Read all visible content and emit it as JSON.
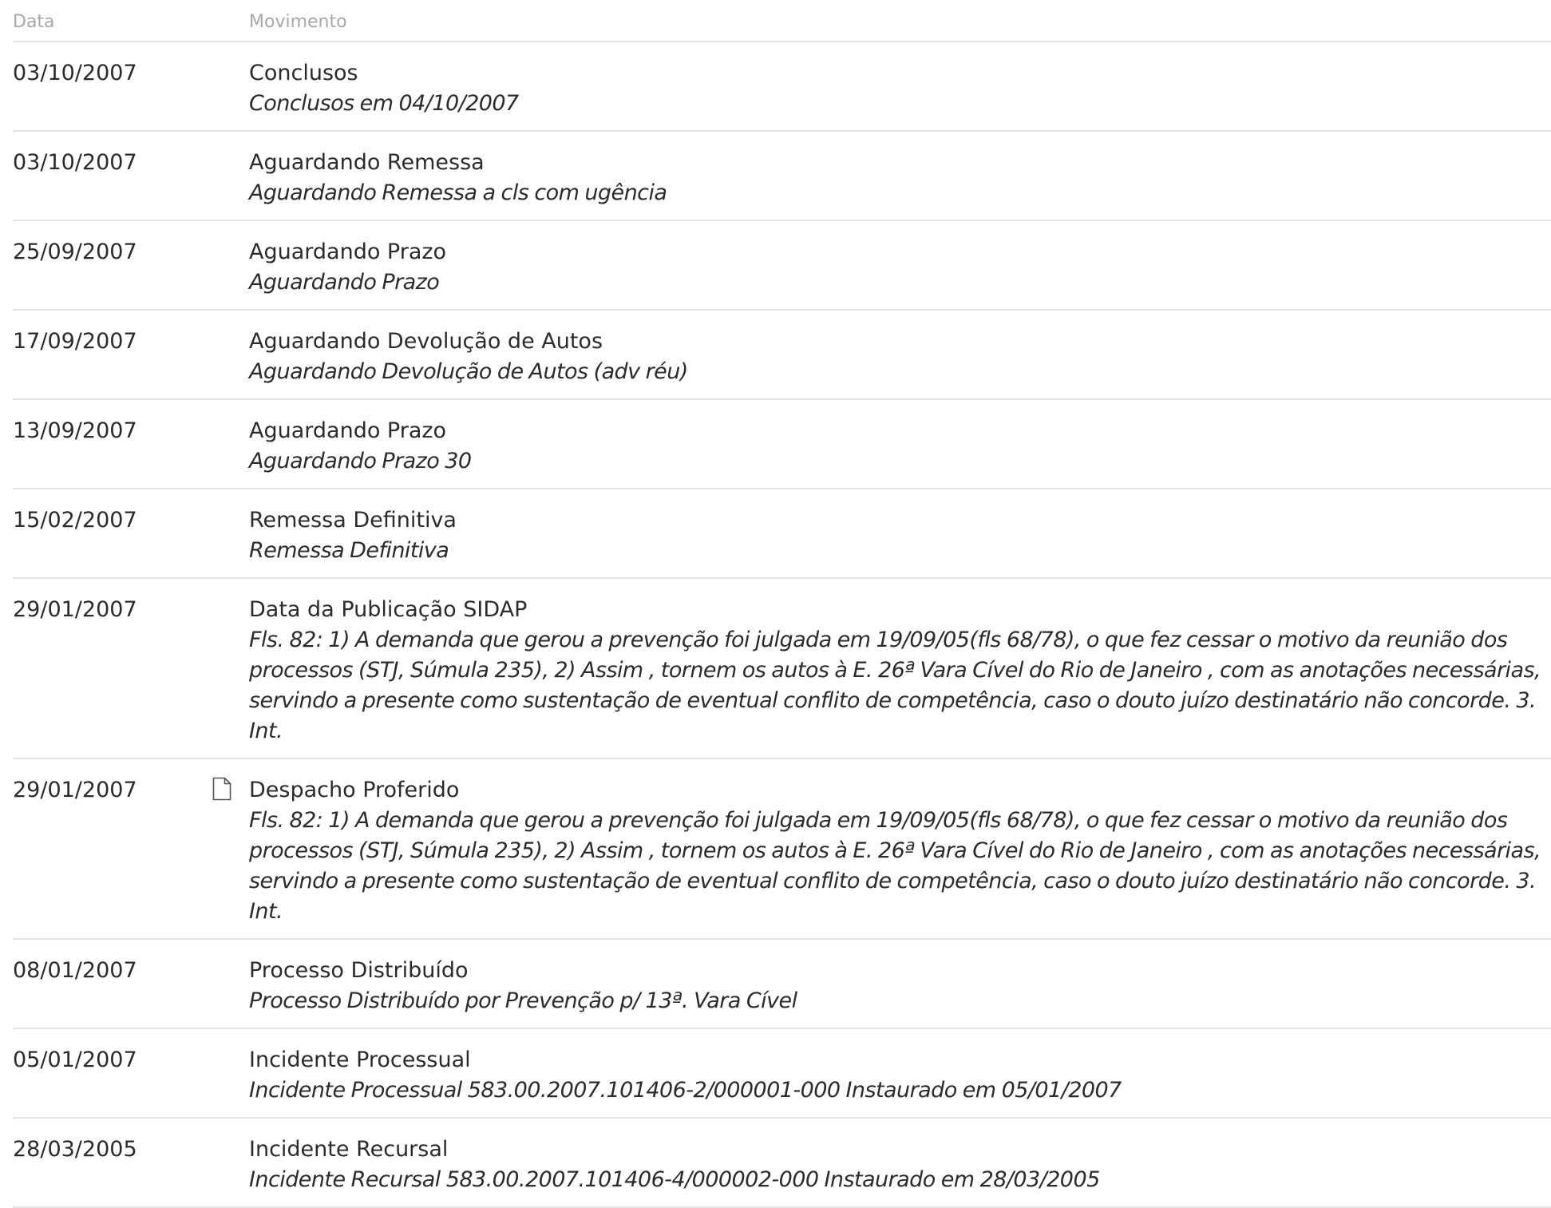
{
  "header": {
    "date_label": "Data",
    "movement_label": "Movimento"
  },
  "rows": [
    {
      "date": "03/10/2007",
      "title": "Conclusos",
      "description": "Conclusos em 04/10/2007",
      "has_document_icon": false
    },
    {
      "date": "03/10/2007",
      "title": "Aguardando Remessa",
      "description": "Aguardando Remessa a cls com ugência",
      "has_document_icon": false
    },
    {
      "date": "25/09/2007",
      "title": "Aguardando Prazo",
      "description": "Aguardando Prazo",
      "has_document_icon": false
    },
    {
      "date": "17/09/2007",
      "title": "Aguardando Devolução de Autos",
      "description": "Aguardando Devolução de Autos (adv réu)",
      "has_document_icon": false
    },
    {
      "date": "13/09/2007",
      "title": "Aguardando Prazo",
      "description": "Aguardando Prazo 30",
      "has_document_icon": false
    },
    {
      "date": "15/02/2007",
      "title": "Remessa Definitiva",
      "description": "Remessa Definitiva",
      "has_document_icon": false
    },
    {
      "date": "29/01/2007",
      "title": "Data da Publicação SIDAP",
      "description": "Fls. 82: 1) A demanda que gerou a prevenção foi julgada em 19/09/05(fls 68/78), o que fez cessar o motivo da reunião dos processos (STJ, Súmula 235), 2) Assim , tornem os autos à E. 26ª Vara Cível do Rio de Janeiro , com as anotações necessárias, servindo a presente como sustentação de eventual conflito de competência, caso o douto juízo destinatário não concorde. 3. Int.",
      "has_document_icon": false
    },
    {
      "date": "29/01/2007",
      "title": "Despacho Proferido",
      "description": "Fls. 82: 1) A demanda que gerou a prevenção foi julgada em 19/09/05(fls 68/78), o que fez cessar o motivo da reunião dos processos (STJ, Súmula 235), 2) Assim , tornem os autos à E. 26ª Vara Cível do Rio de Janeiro , com as anotações necessárias, servindo a presente como sustentação de eventual conflito de competência, caso o douto juízo destinatário não concorde. 3. Int.",
      "has_document_icon": true,
      "icon": "document-icon"
    },
    {
      "date": "08/01/2007",
      "title": "Processo Distribuído",
      "description": "Processo Distribuído por Prevenção p/ 13ª. Vara Cível",
      "has_document_icon": false
    },
    {
      "date": "05/01/2007",
      "title": "Incidente Processual",
      "description": "Incidente Processual 583.00.2007.101406-2/000001-000 Instaurado em 05/01/2007",
      "has_document_icon": false
    },
    {
      "date": "28/03/2005",
      "title": "Incidente Recursal",
      "description": "Incidente Recursal 583.00.2007.101406-4/000002-000 Instaurado em 28/03/2005",
      "has_document_icon": false
    }
  ]
}
